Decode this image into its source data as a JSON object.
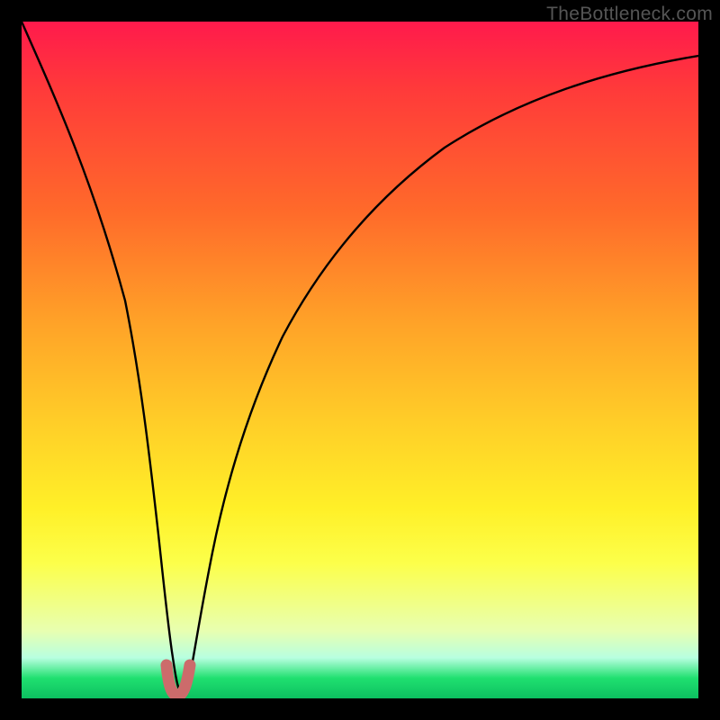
{
  "watermark": "TheBottleneck.com",
  "colors": {
    "frame": "#000000",
    "curve": "#000000",
    "highlight": "#cc6b6b"
  },
  "chart_data": {
    "type": "line",
    "title": "",
    "xlabel": "",
    "ylabel": "",
    "xlim": [
      0,
      100
    ],
    "ylim": [
      0,
      100
    ],
    "series": [
      {
        "name": "bottleneck-curve",
        "x": [
          0,
          3,
          6,
          9,
          12,
          15,
          18,
          19.5,
          21,
          22,
          23,
          24,
          25,
          26,
          28,
          31,
          35,
          40,
          46,
          53,
          61,
          70,
          80,
          90,
          100
        ],
        "y": [
          100,
          88,
          76,
          64,
          52,
          40,
          22,
          12,
          4,
          1,
          0,
          1,
          4,
          10,
          22,
          36,
          49,
          59,
          67,
          73,
          78,
          82,
          85,
          87.5,
          89
        ]
      }
    ],
    "highlight_region": {
      "x": [
        21.3,
        21.8,
        22.3,
        23.0,
        23.7,
        24.2,
        24.7
      ],
      "y": [
        4.2,
        1.6,
        0.6,
        0.3,
        0.6,
        1.6,
        4.2
      ]
    },
    "annotations": []
  }
}
